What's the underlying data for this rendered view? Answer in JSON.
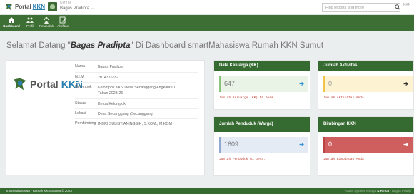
{
  "header": {
    "brand_text": "Portal",
    "brand_accent": "KKN",
    "user_role": "NIT1M",
    "user_name": "Bagas Pradipta ⌄",
    "search_placeholder": "Find reports and more",
    "search_icon": "search-icon",
    "overflow_text": "KKN"
  },
  "nav": {
    "items": [
      {
        "label": "Dashboard",
        "icon": "home-icon"
      },
      {
        "label": "Profil",
        "icon": "users-icon"
      },
      {
        "label": "Penduduk",
        "icon": "people-icon"
      },
      {
        "label": "Aktifitas",
        "icon": "edit-icon"
      }
    ]
  },
  "welcome": {
    "prefix": "Selamat Datang \"",
    "name": "Bagas Pradipta",
    "suffix": "\" Di Dashboard smartMahasiswa Rumah KKN Sumut"
  },
  "profile": {
    "brand_text": "Portal",
    "brand_accent": "KKN",
    "rows": [
      {
        "label": "Nama",
        "value": "Bagas Pradipta"
      },
      {
        "label": "N.I.M",
        "value": "2014376652"
      },
      {
        "label": "Kelompok",
        "value": "Kelompok KKN Desa Secanggang Angkatan 1 Tahun 2023-26"
      },
      {
        "label": "Status",
        "value": "Ketua Kelompok"
      },
      {
        "label": "Lokasi",
        "value": "Desa Secanggang (Secanggang)"
      },
      {
        "label": "Pembimbing",
        "value": "INDRI SULISTIANINGSIH, S.KOM., M.KOM"
      }
    ]
  },
  "stats": {
    "keluarga": {
      "title": "Data Keluarga (KK)",
      "value": "647",
      "note": "Jumlah Keluarga (KK) Di Desa."
    },
    "aktivitas": {
      "title": "Jumlah Aktivitas",
      "value": "0",
      "note": "Jumlah Aktivitas Anda"
    },
    "penduduk": {
      "title": "Jumlah Penduduk (Warga)",
      "value": "1609",
      "note": "Jumlah Penduduk Di Desa."
    },
    "bimbingan": {
      "title": "Bimbingan KKN",
      "value": "0",
      "note": "Jumlah Bimbingan Anda"
    }
  },
  "footer": {
    "left": "smartMahasiswa - Rumah KKN Sumut © 2023",
    "right_prefix": "Katas System Tenaga ",
    "right_bold": "& Rinca",
    "right_suffix": " - Bagas Pradip"
  },
  "colors": {
    "nav_green": "#3d6e33",
    "header_green": "#356a30",
    "accent_blue": "#2a7fb0",
    "danger_red": "#cf5f5f"
  }
}
